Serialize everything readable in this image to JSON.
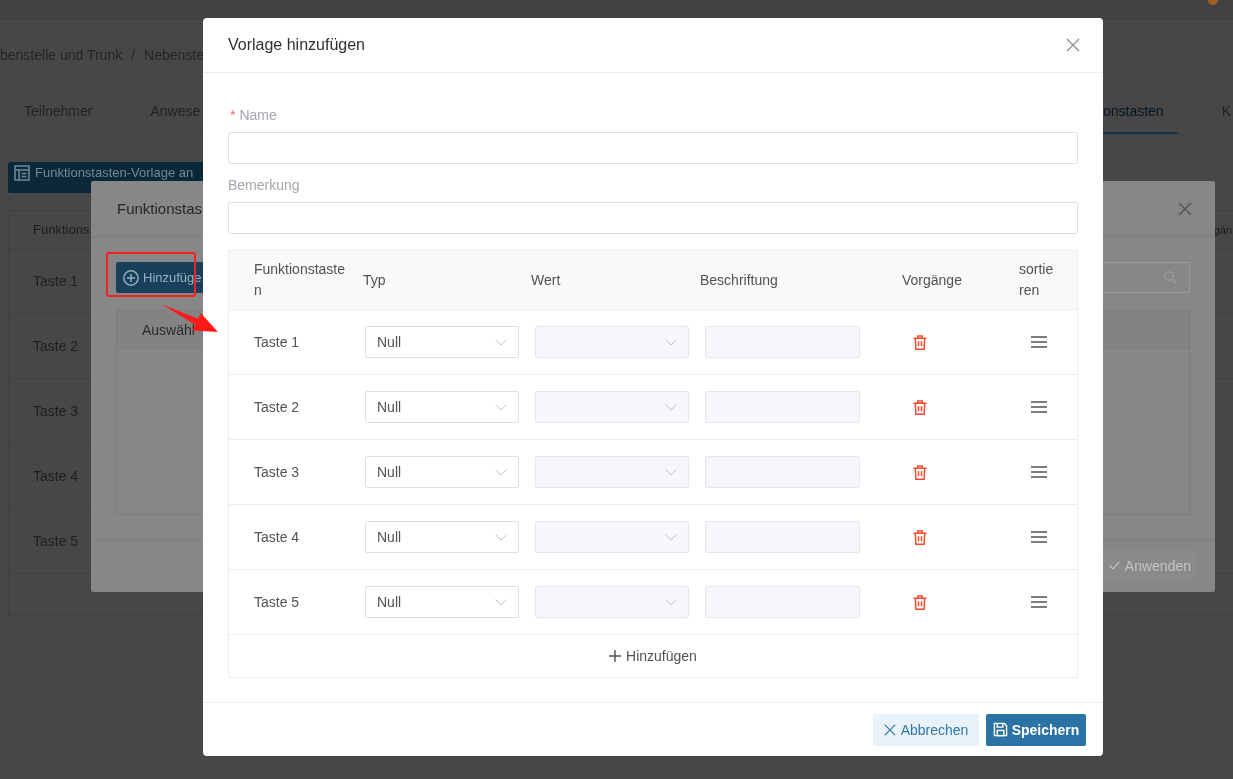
{
  "page": {
    "breadcrumb": [
      "benstelle und Trunk",
      "/",
      "Nebenste"
    ],
    "tabs": [
      {
        "label": "Teilnehmer",
        "selected": false
      },
      {
        "label": "Anwese",
        "selected": false
      },
      {
        "label": "onstasten",
        "selected": true
      },
      {
        "label": "K",
        "selected": false
      }
    ],
    "template_button": "Funktionstasten-Vorlage an",
    "table": {
      "columns": [
        "Funktions",
        "gän"
      ],
      "rows": [
        "Taste 1",
        "Taste 2",
        "Taste 3",
        "Taste 4",
        "Taste 5"
      ]
    }
  },
  "template_dialog": {
    "title": "Funktionstas",
    "add_button": "Hinzufüge",
    "table": {
      "columns": [
        "Auswähl"
      ]
    },
    "apply_button": {
      "label": "Anwenden",
      "disabled": true
    }
  },
  "dialog": {
    "title": "Vorlage hinzufügen",
    "fields": [
      {
        "label": "Name",
        "required_mark": "*"
      },
      {
        "label": "Bemerkung"
      }
    ],
    "table": {
      "columns": [
        "Funktionstasten",
        "Typ",
        "Wert",
        "Beschriftung",
        "Vorgänge",
        "sortieren"
      ],
      "rows": [
        {
          "key": "Taste 1",
          "type": "Null",
          "value_disabled": true,
          "caption_disabled": true
        },
        {
          "key": "Taste 2",
          "type": "Null",
          "value_disabled": true,
          "caption_disabled": true
        },
        {
          "key": "Taste 3",
          "type": "Null",
          "value_disabled": true,
          "caption_disabled": true
        },
        {
          "key": "Taste 4",
          "type": "Null",
          "value_disabled": true,
          "caption_disabled": true
        },
        {
          "key": "Taste 5",
          "type": "Null",
          "value_disabled": true,
          "caption_disabled": true
        }
      ],
      "add_row": "Hinzufügen"
    },
    "buttons": [
      {
        "label": "Abbrechen",
        "kind": "cancel"
      },
      {
        "label": "Speichern",
        "kind": "save"
      }
    ]
  }
}
